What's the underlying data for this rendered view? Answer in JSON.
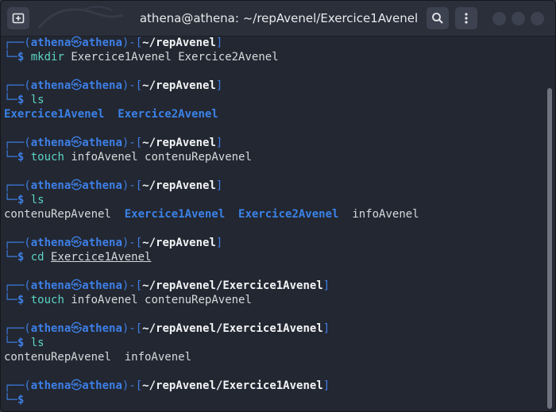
{
  "window": {
    "title": "athena@athena: ~/repAvenel/Exercice1Avenel"
  },
  "icons": {
    "new_tab": "new-tab-icon",
    "search": "search-icon",
    "menu": "kebab-menu-icon",
    "minimize": "minimize-dot",
    "maximize": "maximize-dot",
    "close": "close-dot"
  },
  "colors": {
    "background": "#232731",
    "prompt_frame": "#3d7fe6",
    "command": "#5bd4c6",
    "directory": "#3a82e8",
    "text": "#d7d9dd"
  },
  "prompt": {
    "top_left": "┌──(",
    "user": "athena",
    "at": "㉿",
    "host": "athena",
    "mid": ")-[",
    "close": "]",
    "bottom_left": "└─",
    "dollar": "$"
  },
  "blocks": [
    {
      "path": "~/repAvenel",
      "command": "mkdir",
      "args": "Exercice1Avenel Exercice2Avenel",
      "output": []
    },
    {
      "path": "~/repAvenel",
      "command": "ls",
      "args": "",
      "output": [
        {
          "text": "Exercice1Avenel",
          "type": "dir"
        },
        {
          "text": "Exercice2Avenel",
          "type": "dir"
        }
      ]
    },
    {
      "path": "~/repAvenel",
      "command": "touch",
      "args": "infoAvenel contenuRepAvenel",
      "output": []
    },
    {
      "path": "~/repAvenel",
      "command": "ls",
      "args": "",
      "output": [
        {
          "text": "contenuRepAvenel",
          "type": "file"
        },
        {
          "text": "Exercice1Avenel",
          "type": "dir"
        },
        {
          "text": "Exercice2Avenel",
          "type": "dir"
        },
        {
          "text": "infoAvenel",
          "type": "file"
        }
      ]
    },
    {
      "path": "~/repAvenel",
      "command": "cd",
      "args": "Exercice1Avenel",
      "args_underlined": true,
      "output": []
    },
    {
      "path": "~/repAvenel/Exercice1Avenel",
      "command": "touch",
      "args": "infoAvenel contenuRepAvenel",
      "output": []
    },
    {
      "path": "~/repAvenel/Exercice1Avenel",
      "command": "ls",
      "args": "",
      "output": [
        {
          "text": "contenuRepAvenel",
          "type": "file"
        },
        {
          "text": "infoAvenel",
          "type": "file"
        }
      ]
    },
    {
      "path": "~/repAvenel/Exercice1Avenel",
      "command": "",
      "args": "",
      "output": []
    }
  ]
}
